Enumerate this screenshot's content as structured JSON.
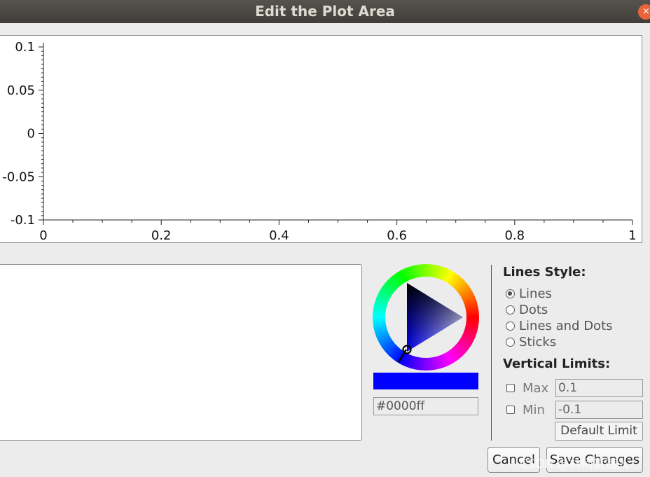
{
  "window": {
    "title": "Edit the Plot Area",
    "close_glyph": "×"
  },
  "plot": {
    "y_ticks": [
      "0.1",
      "0.05",
      "0",
      "-0.05",
      "-0.1"
    ],
    "x_ticks": [
      "0",
      "0.2",
      "0.4",
      "0.6",
      "0.8",
      "1"
    ],
    "xlim": [
      0,
      1
    ],
    "ylim": [
      -0.1,
      0.1
    ]
  },
  "color_picker": {
    "selected_color": "#0000ff",
    "hex_value": "#0000ff"
  },
  "lines_style": {
    "title": "Lines Style:",
    "options": [
      {
        "label": "Lines",
        "checked": true
      },
      {
        "label": "Dots",
        "checked": false
      },
      {
        "label": "Lines and Dots",
        "checked": false
      },
      {
        "label": "Sticks",
        "checked": false
      }
    ]
  },
  "vertical_limits": {
    "title": "Vertical Limits:",
    "max_label": "Max",
    "max_value": "0.1",
    "max_checked": false,
    "min_label": "Min",
    "min_value": "-0.1",
    "min_checked": false,
    "default_button": "Default Limit"
  },
  "buttons": {
    "cancel": "Cancel",
    "save": "Save Changes"
  },
  "watermark": "CSDN @林间饥饿人"
}
